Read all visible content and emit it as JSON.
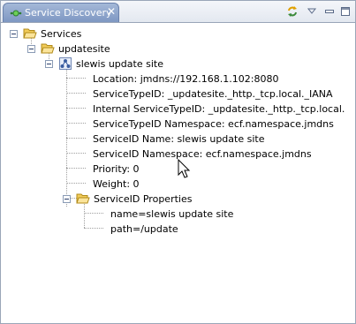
{
  "view": {
    "title": "Service Discovery",
    "close_glyph": "✕",
    "accent": "#7e97c2"
  },
  "toolbar": [
    {
      "name": "refresh-icon"
    },
    {
      "name": "view-menu-icon"
    },
    {
      "name": "minimize-icon"
    },
    {
      "name": "maximize-icon"
    }
  ],
  "tree": {
    "root": "Services",
    "site": "updatesite",
    "service": "slewis update site",
    "properties": [
      "Location: jmdns://192.168.1.102:8080",
      "ServiceTypeID: _updatesite._http._tcp.local._IANA",
      "Internal ServiceTypeID: _updatesite._http._tcp.local.",
      "ServiceTypeID Namespace: ecf.namespace.jmdns",
      "ServiceID Name: slewis update site",
      "ServiceID Namespace: ecf.namespace.jmdns",
      "Priority: 0",
      "Weight: 0"
    ],
    "props_folder": "ServiceID Properties",
    "props_items": [
      "name=slewis update site",
      "path=/update"
    ]
  }
}
